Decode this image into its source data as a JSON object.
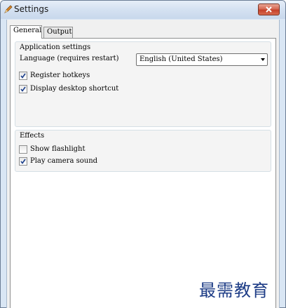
{
  "window": {
    "title": "Settings",
    "close_label": "x"
  },
  "tabs": [
    {
      "label": "General",
      "active": true
    },
    {
      "label": "Output",
      "active": false
    }
  ],
  "application_settings": {
    "group_title": "Application settings",
    "language_label": "Language (requires restart)",
    "language_value": "English (United States)",
    "checkboxes": [
      {
        "label": "Register hotkeys",
        "checked": true
      },
      {
        "label": "Display desktop shortcut",
        "checked": true
      }
    ]
  },
  "effects": {
    "group_title": "Effects",
    "checkboxes": [
      {
        "label": "Show flashlight",
        "checked": false
      },
      {
        "label": "Play camera sound",
        "checked": true
      }
    ]
  },
  "watermark": "最需教育",
  "icons": {
    "app": "pen-icon",
    "close": "close-icon",
    "dropdown": "chevron-down-icon",
    "check": "checkmark-icon"
  },
  "colors": {
    "titlebar": "#d4e1f1",
    "close_button": "#c4402a",
    "watermark": "#1d3c86"
  }
}
